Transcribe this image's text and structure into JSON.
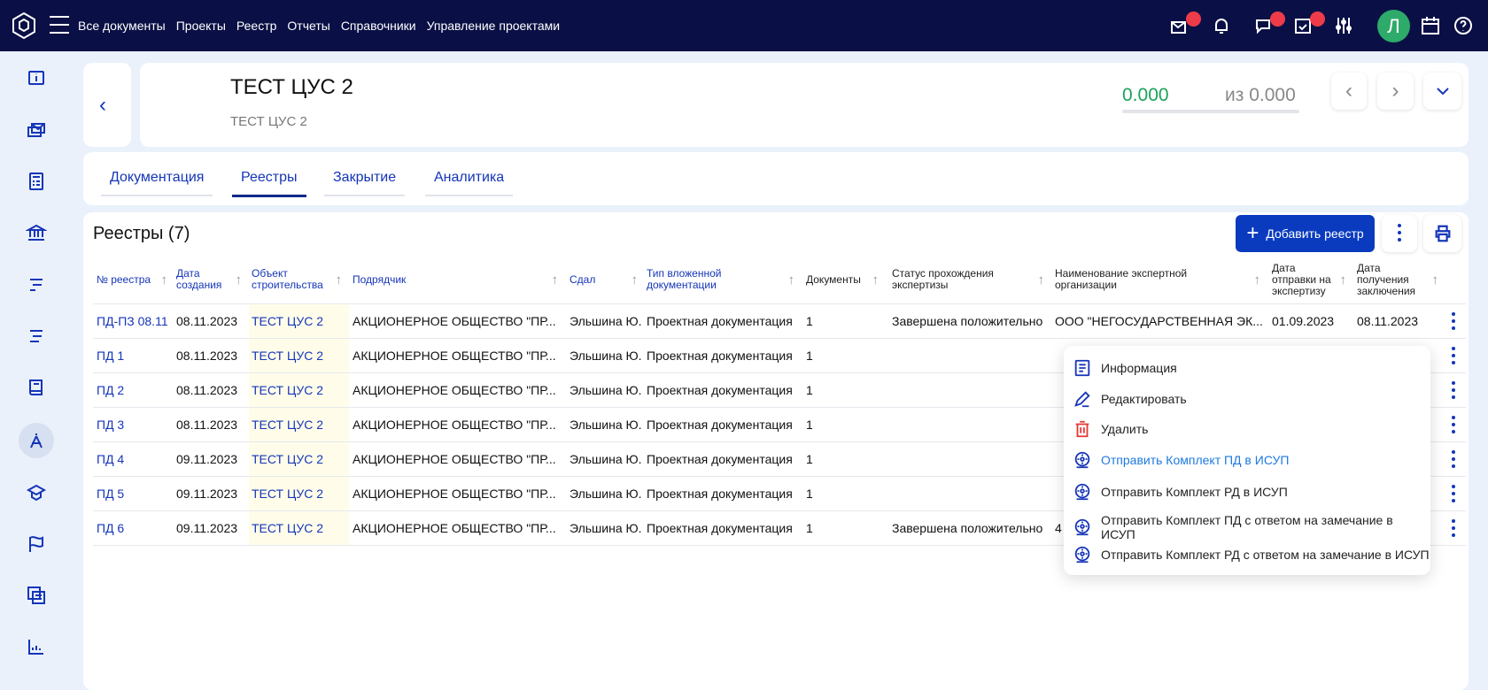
{
  "header": {
    "nav": [
      "Все документы",
      "Проекты",
      "Реестр",
      "Отчеты",
      "Справочники",
      "Управление проектами"
    ],
    "avatar_letter": "Л",
    "notification_color": "#ee3b4a"
  },
  "sidebar": {
    "icons": [
      "info-icon",
      "mail-stack-icon",
      "calculator-icon",
      "bank-icon",
      "list-align-icon",
      "list-align-icon-2",
      "book-icon",
      "compass-icon",
      "graduation-icon",
      "flag-icon",
      "documents-icon",
      "chart-icon"
    ],
    "active": "compass-icon"
  },
  "project": {
    "title": "ТЕСТ ЦУС 2",
    "subtitle": "ТЕСТ ЦУС 2",
    "progress_value": "0.000",
    "progress_total": "из 0.000"
  },
  "tabs": [
    {
      "label": "Документация"
    },
    {
      "label": "Реестры",
      "active": true
    },
    {
      "label": "Закрытие"
    },
    {
      "label": "Аналитика"
    }
  ],
  "registry": {
    "title": "Реестры (7)",
    "add_label": "Добавить реестр",
    "columns": [
      "№ реестра",
      "Дата создания",
      "Объект строительства",
      "Подрядчик",
      "Сдал",
      "Тип вложенной документации",
      "Документы",
      "Статус прохождения экспертизы",
      "Наименование экспертной организации",
      "Дата отправки на экспертизу",
      "Дата получения заключения"
    ],
    "rows": [
      [
        "ПД-ПЗ 08.11",
        "08.11.2023",
        "ТЕСТ ЦУС 2",
        "АКЦИОНЕРНОЕ ОБЩЕСТВО \"ПР...",
        "Эльшина Ю.",
        "Проектная документация",
        "1",
        "Завершена положительно",
        "ООО \"НЕГОСУДАРСТВЕННАЯ ЭК...",
        "01.09.2023",
        "08.11.2023"
      ],
      [
        "ПД 1",
        "08.11.2023",
        "ТЕСТ ЦУС 2",
        "АКЦИОНЕРНОЕ ОБЩЕСТВО \"ПР...",
        "Эльшина Ю.",
        "Проектная документация",
        "1",
        "",
        "",
        "",
        ""
      ],
      [
        "ПД 2",
        "08.11.2023",
        "ТЕСТ ЦУС 2",
        "АКЦИОНЕРНОЕ ОБЩЕСТВО \"ПР...",
        "Эльшина Ю.",
        "Проектная документация",
        "1",
        "",
        "",
        "",
        ""
      ],
      [
        "ПД 3",
        "08.11.2023",
        "ТЕСТ ЦУС 2",
        "АКЦИОНЕРНОЕ ОБЩЕСТВО \"ПР...",
        "Эльшина Ю.",
        "Проектная документация",
        "1",
        "",
        "",
        "",
        ""
      ],
      [
        "ПД 4",
        "09.11.2023",
        "ТЕСТ ЦУС 2",
        "АКЦИОНЕРНОЕ ОБЩЕСТВО \"ПР...",
        "Эльшина Ю.",
        "Проектная документация",
        "1",
        "",
        "",
        "",
        ""
      ],
      [
        "ПД 5",
        "09.11.2023",
        "ТЕСТ ЦУС 2",
        "АКЦИОНЕРНОЕ ОБЩЕСТВО \"ПР...",
        "Эльшина Ю.",
        "Проектная документация",
        "1",
        "",
        "",
        "",
        ""
      ],
      [
        "ПД 6",
        "09.11.2023",
        "ТЕСТ ЦУС 2",
        "АКЦИОНЕРНОЕ ОБЩЕСТВО \"ПР...",
        "Эльшина Ю.",
        "Проектная документация",
        "1",
        "Завершена положительно",
        "4",
        "",
        ""
      ]
    ]
  },
  "context_menu": [
    {
      "label": "Информация",
      "icon": "info-document-icon"
    },
    {
      "label": "Редактировать",
      "icon": "pencil-icon"
    },
    {
      "label": "Удалить",
      "icon": "trash-icon",
      "color": "#e53935"
    },
    {
      "label": "Отправить Комплект ПД в ИСУП",
      "icon": "send-wheel-icon",
      "highlighted": true
    },
    {
      "label": "Отправить Комплект РД в ИСУП",
      "icon": "send-wheel-icon"
    },
    {
      "label": "Отправить Комплект ПД с ответом на замечание в ИСУП",
      "icon": "send-wheel-icon"
    },
    {
      "label": "Отправить Комплект РД с ответом на замечание в ИСУП",
      "icon": "send-wheel-icon"
    }
  ]
}
